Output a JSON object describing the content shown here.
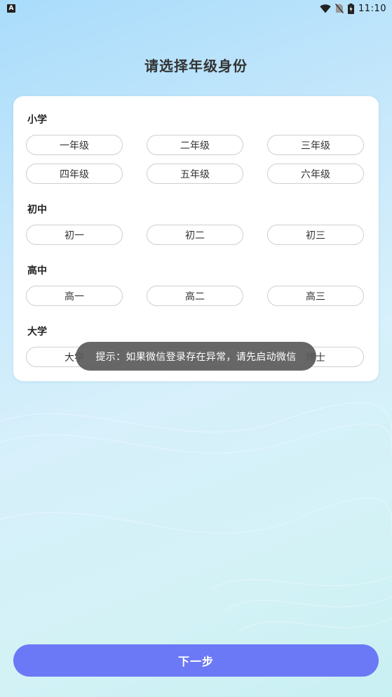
{
  "status_bar": {
    "notification_icon_letter": "A",
    "time": "11:10",
    "icons": [
      "wifi-icon",
      "no-sim-icon",
      "battery-charging-icon"
    ]
  },
  "title": "请选择年级身份",
  "sections": [
    {
      "title": "小学",
      "grades": [
        "一年级",
        "二年级",
        "三年级",
        "四年级",
        "五年级",
        "六年级"
      ]
    },
    {
      "title": "初中",
      "grades": [
        "初一",
        "初二",
        "初三"
      ]
    },
    {
      "title": "高中",
      "grades": [
        "高一",
        "高二",
        "高三"
      ]
    },
    {
      "title": "大学",
      "grades": [
        "大学",
        "",
        "博士"
      ]
    }
  ],
  "toast": "提示：如果微信登录存在异常，请先启动微信",
  "next_button": "下一步"
}
